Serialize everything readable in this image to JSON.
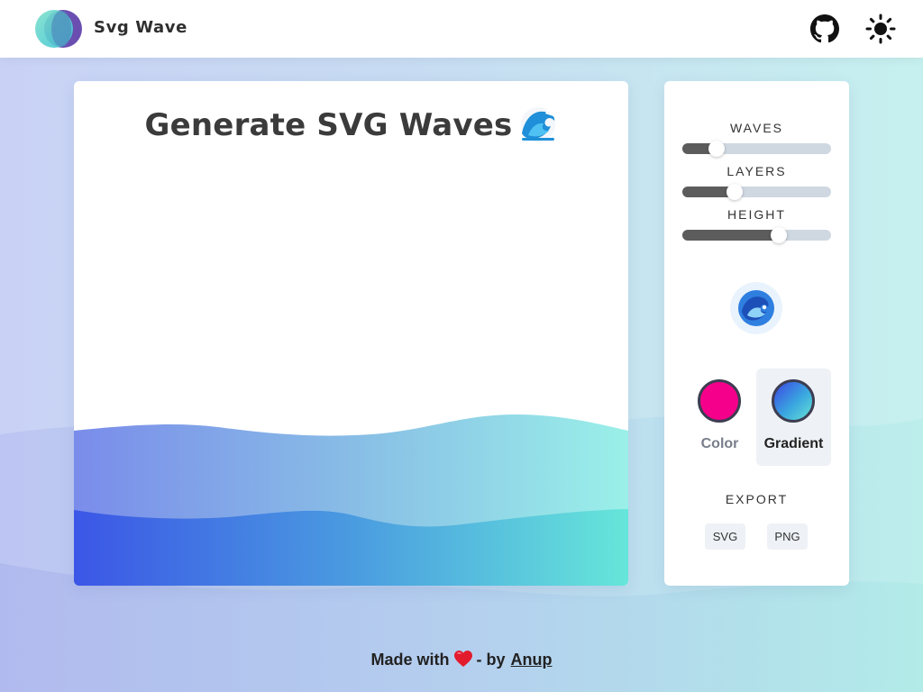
{
  "header": {
    "brand": "Svg Wave",
    "logo_icon": "overlapping-circles-logo",
    "github_icon": "github-icon",
    "theme_icon": "sun-icon"
  },
  "preview": {
    "title": "Generate SVG Waves",
    "title_icon": "water-wave-emoji",
    "gradient_colors": [
      "#3b56e6",
      "#4a9be0",
      "#66e6da"
    ]
  },
  "controls": {
    "waves": {
      "label": "WAVES",
      "value": 0.23
    },
    "layers": {
      "label": "LAYERS",
      "value": 0.35
    },
    "height": {
      "label": "HEIGHT",
      "value": 0.65
    },
    "randomize_icon": "wave-randomize-icon",
    "modes": [
      {
        "label": "Color",
        "color": "#f5008a",
        "selected": false
      },
      {
        "label": "Gradient",
        "color_from": "#3b46e4",
        "color_to": "#66e3d5",
        "selected": true
      }
    ],
    "export": {
      "label": "EXPORT",
      "svg_label": "SVG",
      "png_label": "PNG"
    }
  },
  "footer": {
    "made_with": "Made with",
    "heart_icon": "heart-icon",
    "by": "- by",
    "author": "Anup"
  }
}
